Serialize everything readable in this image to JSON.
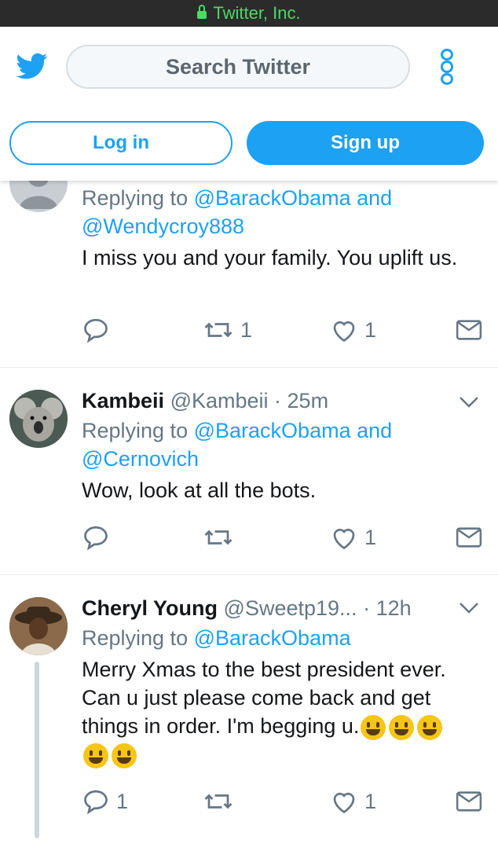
{
  "statusbar": {
    "title": "Twitter, Inc."
  },
  "header": {
    "search_placeholder": "Search Twitter",
    "login_label": "Log in",
    "signup_label": "Sign up"
  },
  "colors": {
    "accent": "#1da1f2",
    "muted": "#657786",
    "secure": "#4cd964"
  },
  "tweets": [
    {
      "name": "",
      "handle": "",
      "time": "",
      "replying_to": "Replying to",
      "mentions": "@BarackObama and @Wendycroy888",
      "text": "I miss you and your family. You uplift us.",
      "replies": "",
      "retweets": "1",
      "likes": "1"
    },
    {
      "name": "Kambeii",
      "handle": "@Kambeii",
      "time": "· 25m",
      "replying_to": "Replying to",
      "mentions": "@BarackObama and @Cernovich",
      "text": "Wow, look at all the bots.",
      "replies": "",
      "retweets": "",
      "likes": "1"
    },
    {
      "name": "Cheryl Young",
      "handle": "@Sweetp19...",
      "time": "· 12h",
      "replying_to": "Replying to",
      "mentions": "@BarackObama",
      "text": "Merry Xmas to the best president ever. Can u just please come back and get things in order. I'm begging u.",
      "replies": "1",
      "retweets": "",
      "likes": "1"
    }
  ]
}
